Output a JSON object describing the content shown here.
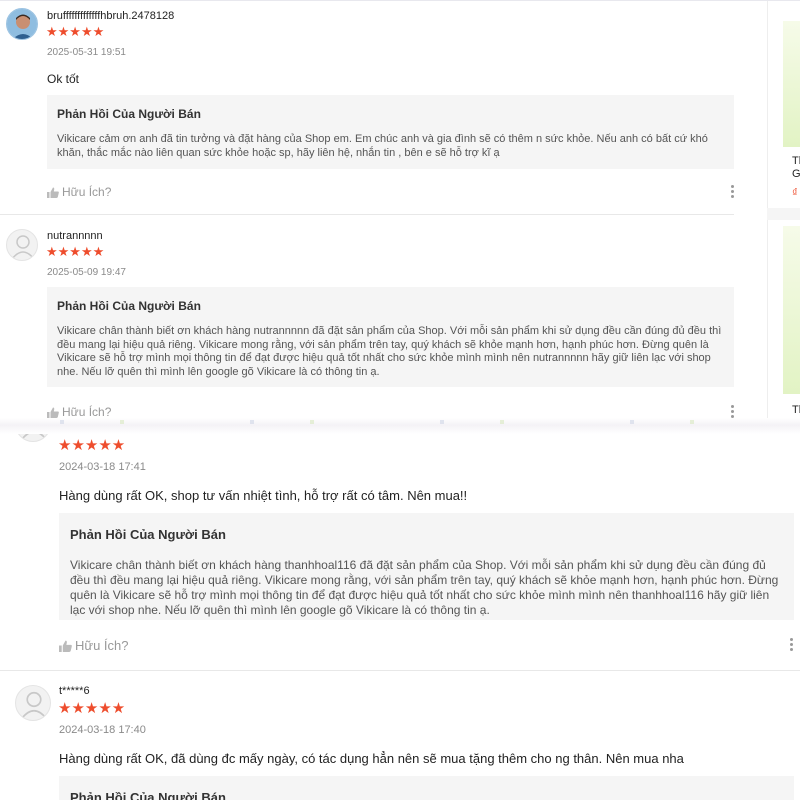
{
  "reviews_top": [
    {
      "username": "brufffffffffffffhbruh.2478128",
      "stars": "★★★★★",
      "date": "2025-05-31 19:51",
      "comment": "Ok tốt",
      "reply_title": "Phản Hồi Của Người Bán",
      "reply_text": "Vikicare cảm ơn anh đã tin tưởng và đặt hàng của Shop em. Em chúc anh và gia đình sẽ có thêm n sức khỏe. Nếu anh có bất cứ khó khăn, thắc mắc nào liên quan sức khỏe hoặc sp, hãy liên hệ, nhắn tin , bên e sẽ hỗ trợ kĩ ạ",
      "helpful_label": "Hữu Ích?"
    },
    {
      "username": "nutrannnnn",
      "stars": "★★★★★",
      "date": "2025-05-09 19:47",
      "reply_title": "Phản Hồi Của Người Bán",
      "reply_text": "Vikicare chân thành biết ơn khách hàng nutrannnnn đã đặt sản phẩm của Shop. Với mỗi sản phẩm khi sử dụng đều cần đúng đủ đều thì đều mang lại hiệu quả riêng. Vikicare mong rằng, với sản phẩm trên tay, quý khách sẽ khỏe mạnh hơn, hạnh phúc hơn. Đừng quên là Vikicare sẽ hỗ trợ mình mọi thông tin để đạt được hiệu quả tốt nhất cho sức khỏe mình mình nên nutrannnnn hãy giữ liên lạc với shop nhe. Nếu lỡ quên thì mình lên google gõ Vikicare là có thông tin ạ.",
      "helpful_label": "Hữu Ích?"
    }
  ],
  "reviews_bottom": [
    {
      "stars": "★★★★★",
      "date": "2024-03-18 17:41",
      "comment": "Hàng dùng rất OK, shop tư vấn nhiệt tình, hỗ trợ rất có tâm. Nên mua!!",
      "reply_title": "Phản Hồi Của Người Bán",
      "reply_text": "Vikicare chân thành biết ơn khách hàng thanhhoal116 đã đặt sản phẩm của Shop. Với mỗi sản phẩm khi sử dụng đều cần đúng đủ đều thì đều mang lại hiệu quả riêng. Vikicare mong rằng, với sản phẩm trên tay, quý khách sẽ khỏe mạnh hơn, hạnh phúc hơn. Đừng quên là Vikicare sẽ hỗ trợ mình mọi thông tin để đạt được hiệu quả tốt nhất cho sức khỏe mình mình nên thanhhoal116 hãy giữ liên lạc với shop nhe. Nếu lỡ quên thì mình lên google gõ Vikicare là có thông tin ạ.",
      "helpful_label": "Hữu Ích?"
    },
    {
      "username": "t*****6",
      "stars": "★★★★★",
      "date": "2024-03-18 17:40",
      "comment": "Hàng dùng rất OK, đã dùng đc mấy ngày, có tác dụng hẳn nên sẽ mua tặng thêm cho ng thân. Nên mua nha",
      "reply_title": "Phản Hồi Của Người Bán"
    }
  ],
  "sidebar": {
    "card1_text_a": "Th",
    "card1_text_b": "G",
    "card1_price": "₫",
    "card2_text": "Th"
  },
  "colors": {
    "star": "#ee4d2d",
    "reply_bg": "#f5f5f5",
    "meta": "#8a8a8a"
  }
}
